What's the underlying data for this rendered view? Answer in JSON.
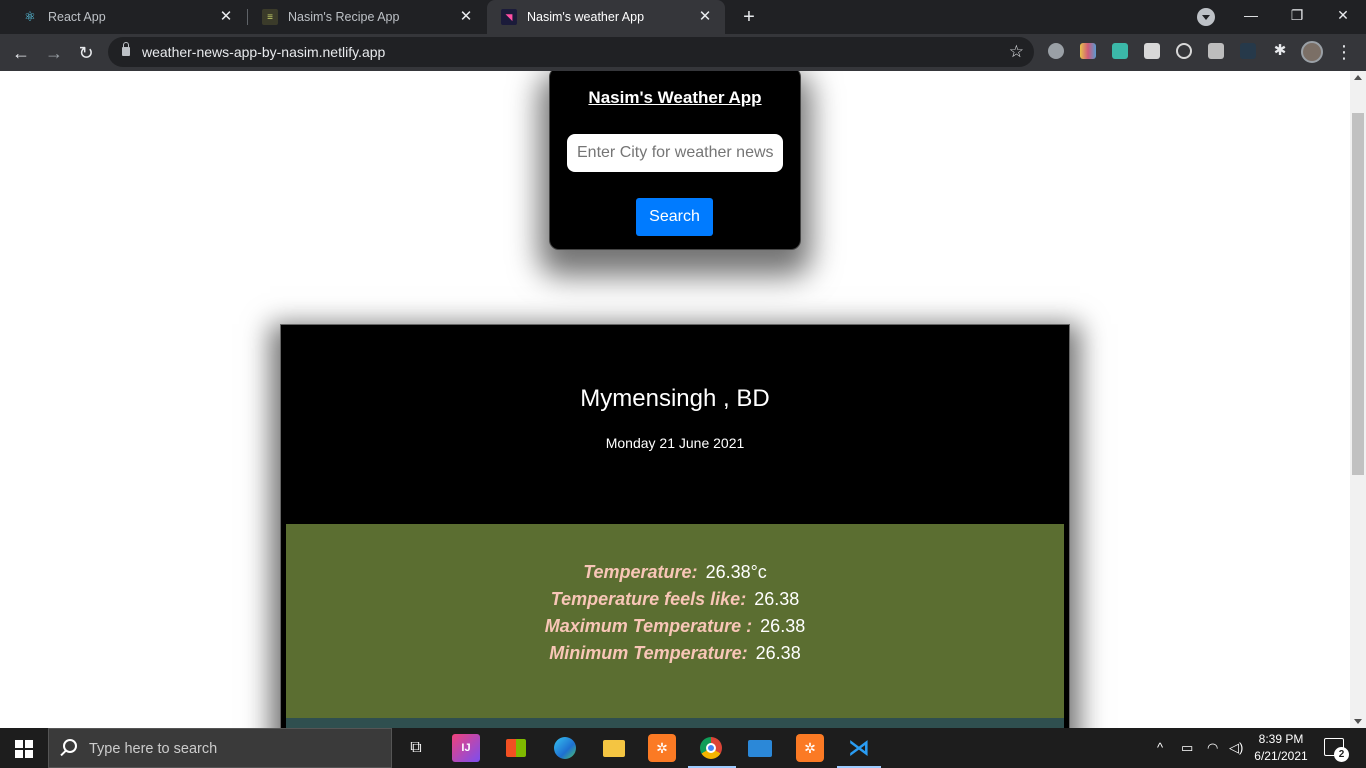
{
  "browser": {
    "tabs": [
      {
        "title": "React App",
        "favicon": "react-icon",
        "active": false
      },
      {
        "title": "Nasim's Recipe App",
        "favicon": "recipe-icon",
        "active": false
      },
      {
        "title": "Nasim's weather App",
        "favicon": "weather-icon",
        "active": true
      }
    ],
    "url": "weather-news-app-by-nasim.netlify.app"
  },
  "app": {
    "title": "Nasim's Weather App",
    "search_placeholder": "Enter City for weather news",
    "search_button": "Search"
  },
  "weather": {
    "location": "Mymensingh , BD",
    "date": "Monday 21 June 2021",
    "rows": [
      {
        "label": "Temperature:",
        "value": "26.38°c"
      },
      {
        "label": "Temperature feels like:",
        "value": "26.38"
      },
      {
        "label": "Maximum Temperature :",
        "value": "26.38"
      },
      {
        "label": "Minimum Temperature:",
        "value": "26.38"
      }
    ]
  },
  "taskbar": {
    "search_placeholder": "Type here to search",
    "time": "8:39 PM",
    "date": "6/21/2021",
    "notifications": "2"
  },
  "colors": {
    "accent_button": "#007bff",
    "temp_panel": "#5b6e31",
    "temp_label": "#f8c6b7"
  }
}
